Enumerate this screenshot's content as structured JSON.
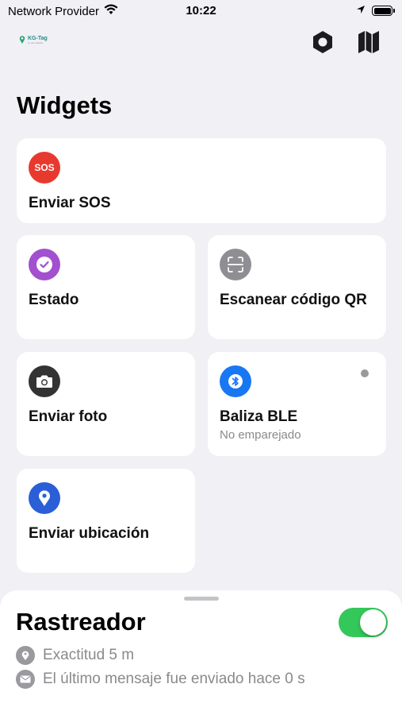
{
  "status_bar": {
    "carrier": "Network Provider",
    "time": "10:22"
  },
  "app": {
    "logo_text": "KG-Tag",
    "logo_sub": "by dormakaba"
  },
  "main": {
    "title": "Widgets",
    "widgets": [
      {
        "label": "Enviar SOS",
        "icon": "sos-icon",
        "icon_text": "SOS",
        "color": "#e8392f"
      },
      {
        "label": "Estado",
        "icon": "check-circle-icon",
        "color": "#a24fd0"
      },
      {
        "label": "Escanear código QR",
        "icon": "qr-scan-icon",
        "color": "#8e8e93"
      },
      {
        "label": "Enviar foto",
        "icon": "camera-icon",
        "color": "#333333"
      },
      {
        "label": "Baliza BLE",
        "sublabel": "No emparejado",
        "icon": "bluetooth-icon",
        "color": "#1877f2"
      },
      {
        "label": "Enviar ubicación",
        "icon": "location-pin-icon",
        "color": "#2a5fd8"
      }
    ]
  },
  "tracker": {
    "title": "Rastreador",
    "enabled": true,
    "accent": "#34c759",
    "accuracy": "Exactitud 5 m",
    "last_message": "El último mensaje fue enviado hace 0 s"
  }
}
